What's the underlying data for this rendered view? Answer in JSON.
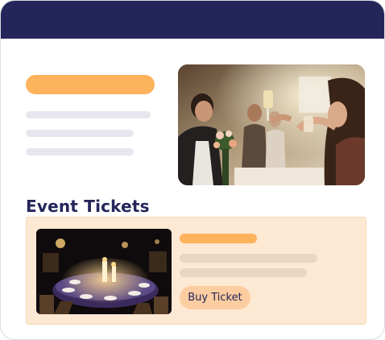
{
  "colors": {
    "topbar": "#24265a",
    "accent": "#fdb25c",
    "placeholder_line": "#e6e7ee",
    "card_bg": "#fde8d3",
    "button_bg": "#fccda0",
    "title_text": "#24265a"
  },
  "section": {
    "title": "Event Tickets"
  },
  "ticket": {
    "buy_label": "Buy Ticket"
  },
  "images": {
    "hero": "wedding-toast-photo",
    "event": "banquet-table-photo"
  }
}
